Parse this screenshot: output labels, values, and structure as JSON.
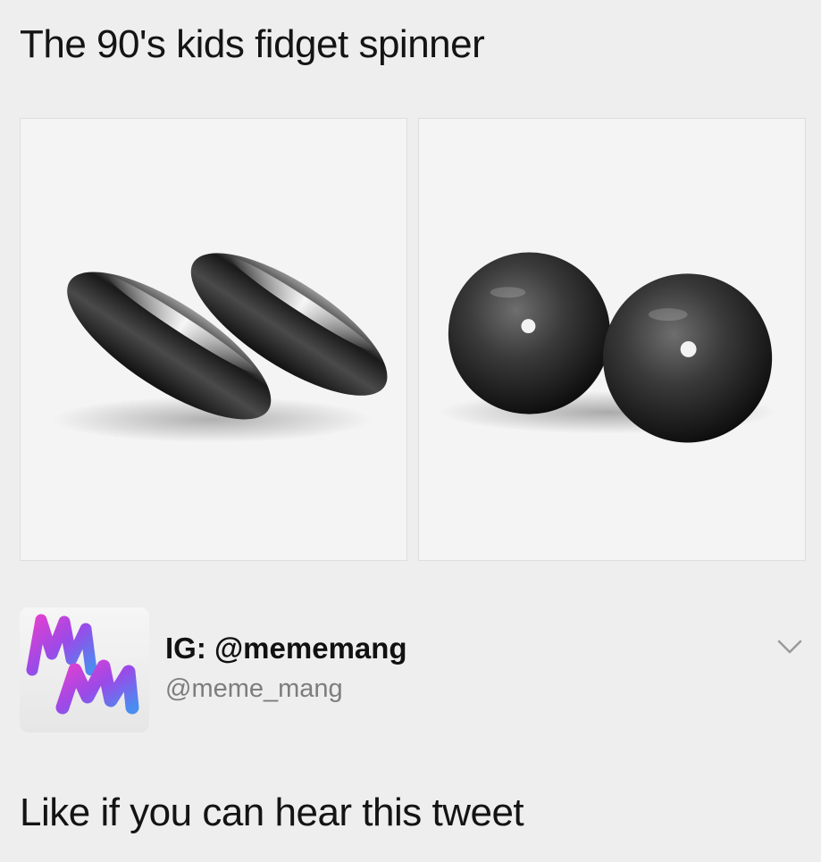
{
  "post": {
    "title": "The 90's kids fidget spinner",
    "images": [
      {
        "icon": "oval-magnets-icon"
      },
      {
        "icon": "spherical-magnets-icon"
      }
    ]
  },
  "account": {
    "avatar_icon": "mm-logo-icon",
    "display_name": "IG: @mememang",
    "handle": "@meme_mang",
    "menu_icon": "chevron-down-icon"
  },
  "tweet": {
    "text": "Like if you can hear this tweet"
  },
  "colors": {
    "background": "#eeeeee",
    "text": "#141414",
    "handle": "#7d7d7d",
    "logo_gradient": [
      "#4a8cf0",
      "#9a4ae8",
      "#e040d0"
    ]
  }
}
